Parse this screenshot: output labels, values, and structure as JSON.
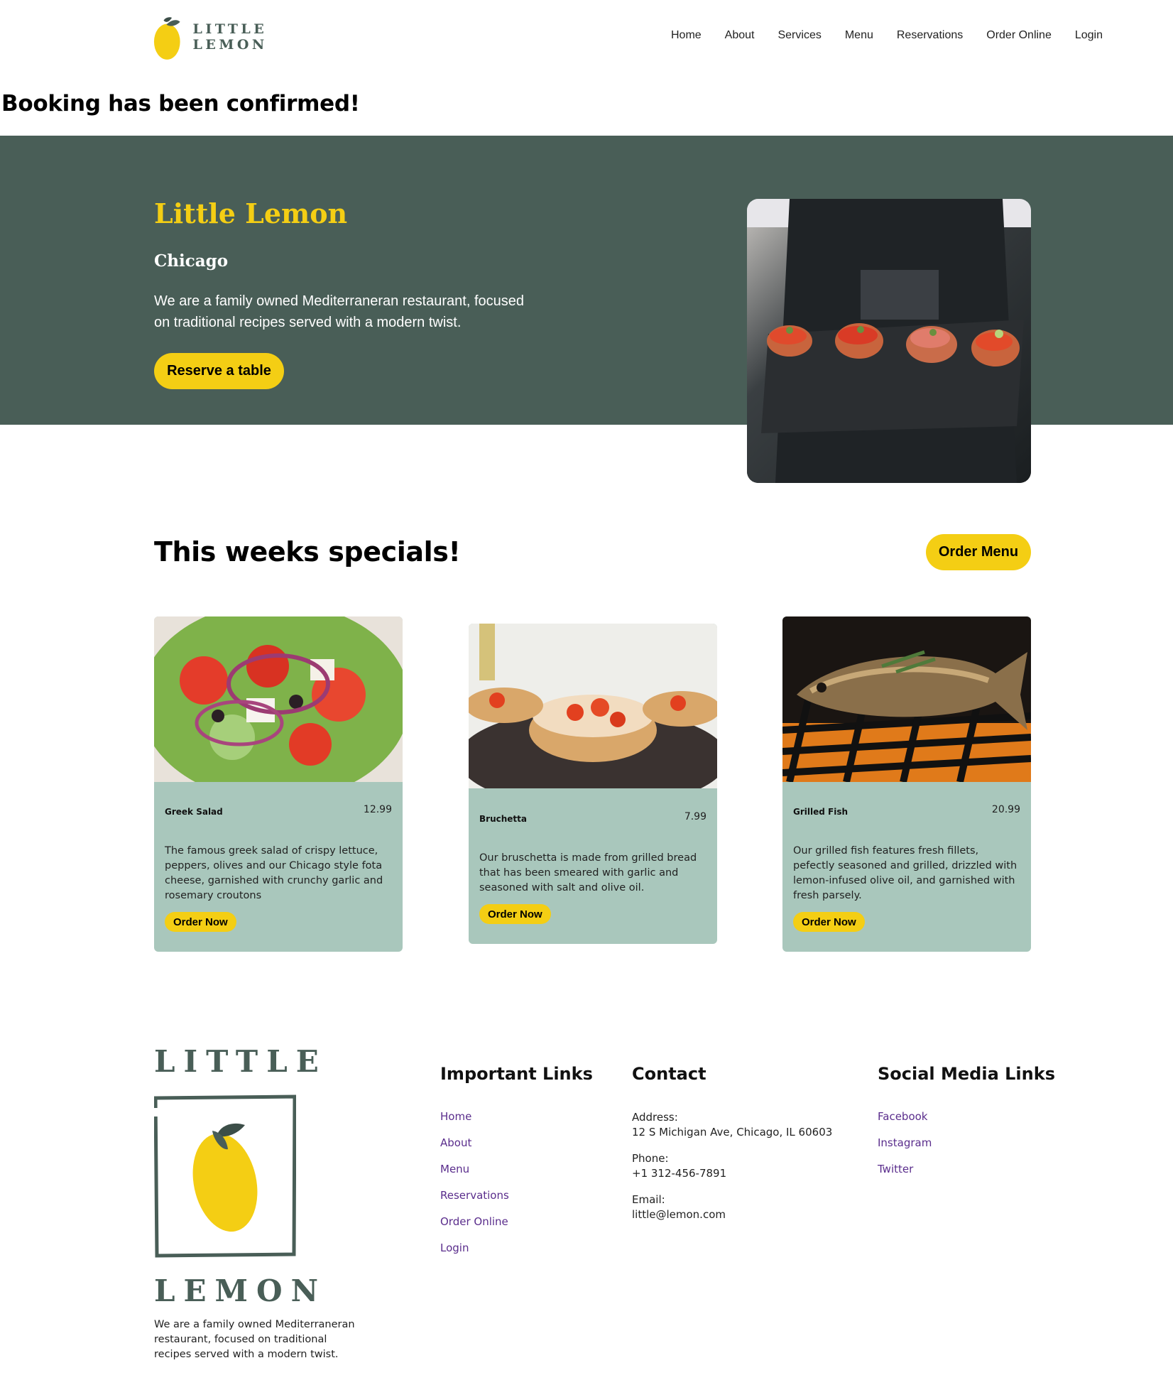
{
  "brand": {
    "logo_text": "LITTLE LEMON",
    "primary_color": "#495e57",
    "accent_color": "#f4ce14",
    "card_color": "#a9c7bc"
  },
  "nav": {
    "items": [
      "Home",
      "About",
      "Services",
      "Menu",
      "Reservations",
      "Order Online",
      "Login"
    ]
  },
  "confirmation": {
    "message": "Booking has been confirmed!"
  },
  "hero": {
    "title": "Little Lemon",
    "subtitle": "Chicago",
    "description": "We are a family owned Mediterraneran restaurant, focused on traditional recipes served with a modern twist.",
    "button_label": "Reserve a table"
  },
  "specials": {
    "title": "This weeks specials!",
    "order_menu_label": "Order Menu",
    "cards": [
      {
        "name": "Greek Salad",
        "price": "12.99",
        "description": "The famous greek salad of crispy lettuce, peppers, olives and our Chicago style fota cheese, garnished with crunchy garlic and rosemary croutons",
        "button_label": "Order Now"
      },
      {
        "name": "Bruchetta",
        "price": "7.99",
        "description": "Our bruschetta is made from grilled bread that has been smeared with garlic and seasoned with salt and olive oil.",
        "button_label": "Order Now"
      },
      {
        "name": "Grilled Fish",
        "price": "20.99",
        "description": "Our grilled fish features fresh fillets, pefectly seasoned and grilled, drizzled with lemon-infused olive oil, and garnished with fresh parsely.",
        "button_label": "Order Now"
      }
    ]
  },
  "footer": {
    "logo_top": "LITTLE",
    "logo_bottom": "LEMON",
    "about": "We are a family owned Mediterraneran restaurant, focused on traditional recipes served with a modern twist.",
    "important_links": {
      "title": "Important Links",
      "items": [
        "Home",
        "About",
        "Menu",
        "Reservations",
        "Order Online",
        "Login"
      ]
    },
    "contact": {
      "title": "Contact",
      "address_label": "Address:",
      "address": "12 S Michigan Ave, Chicago, IL 60603",
      "phone_label": "Phone:",
      "phone": "+1 312-456-7891",
      "email_label": "Email:",
      "email": "little@lemon.com"
    },
    "social": {
      "title": "Social Media Links",
      "items": [
        "Facebook",
        "Instagram",
        "Twitter"
      ]
    }
  }
}
